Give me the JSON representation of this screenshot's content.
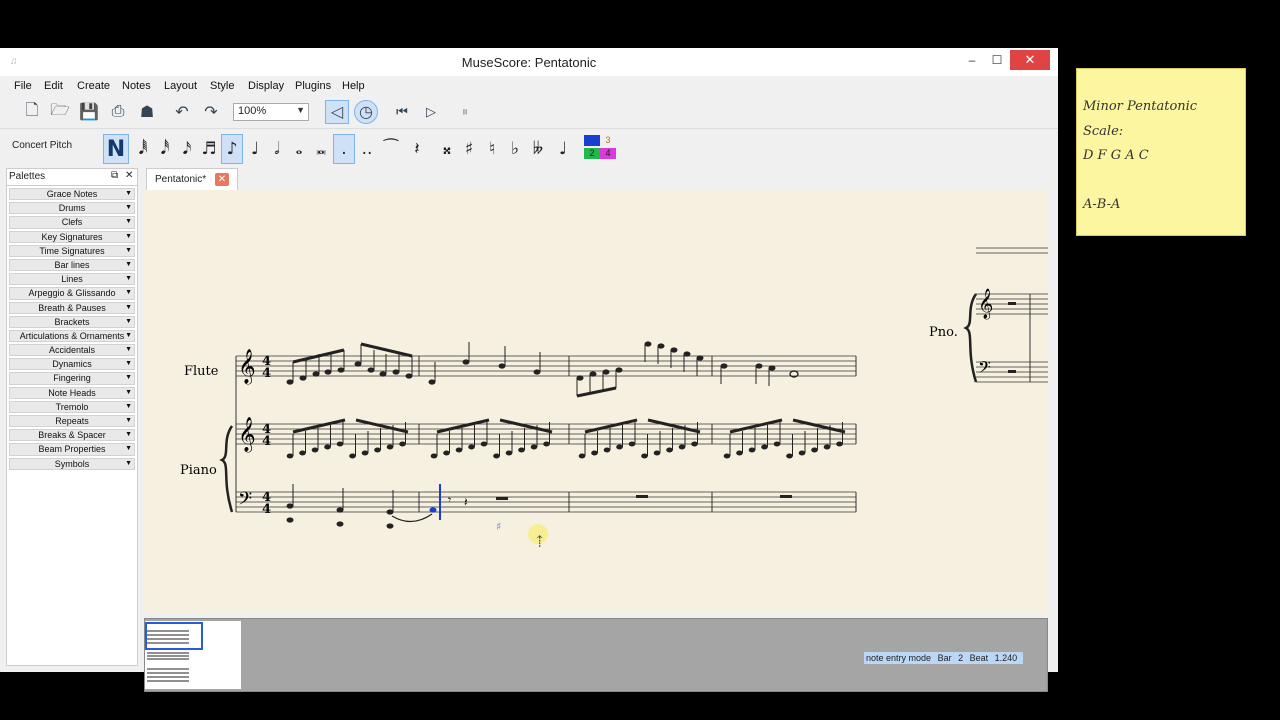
{
  "window": {
    "title": "MuseScore: Pentatonic",
    "controls": {
      "minimize": "–",
      "maximize": "☐",
      "close": "✕"
    }
  },
  "menu": [
    "File",
    "Edit",
    "Create",
    "Notes",
    "Layout",
    "Style",
    "Display",
    "Plugins",
    "Help"
  ],
  "toolbar": {
    "zoom_value": "100%",
    "icons": [
      "new-file-icon",
      "open-file-icon",
      "save-icon",
      "print-icon",
      "upload-icon",
      "undo-icon",
      "redo-icon",
      "speaker-icon",
      "metronome-icon",
      "rewind-icon",
      "play-icon",
      "pause-icon"
    ]
  },
  "note_input": {
    "concert_pitch": "Concert Pitch",
    "note_mode": "N",
    "voices": [
      "1",
      "2",
      "3",
      "4"
    ],
    "voice_colors": [
      "#1a3fcf",
      "#1fb84a",
      "#e0a030",
      "#d93ad9"
    ]
  },
  "palettes": {
    "title": "Palettes",
    "items": [
      "Grace Notes",
      "Drums",
      "Clefs",
      "Key Signatures",
      "Time Signatures",
      "Bar lines",
      "Lines",
      "Arpeggio & Glissando",
      "Breath & Pauses",
      "Brackets",
      "Articulations & Ornaments",
      "Accidentals",
      "Dynamics",
      "Fingering",
      "Note Heads",
      "Tremolo",
      "Repeats",
      "Breaks & Spacer",
      "Beam Properties",
      "Symbols"
    ]
  },
  "tabs": [
    {
      "label": "Pentatonic*"
    }
  ],
  "score": {
    "instruments": {
      "flute": "Flute",
      "piano": "Piano",
      "piano_short": "Pno."
    },
    "time_signature": {
      "top": "4",
      "bottom": "4"
    }
  },
  "status": {
    "mode": "note entry mode",
    "bar_label": "Bar",
    "bar": "2",
    "beat_label": "Beat",
    "beat": "1.240"
  },
  "sticky_note": {
    "lines": [
      "Minor Pentatonic",
      "Scale:",
      "D F G A C",
      "",
      "A-B-A"
    ]
  },
  "colors": {
    "selection": "#1a3fcf",
    "paper": "#f6f0e0",
    "close_button": "#e04343",
    "sticky": "#fdf6a0"
  }
}
